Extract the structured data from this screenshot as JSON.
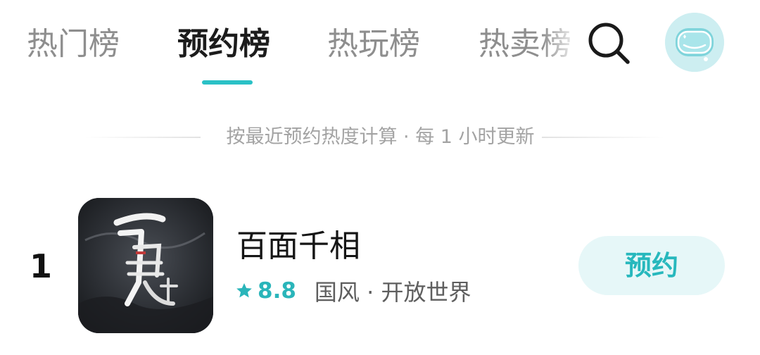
{
  "tabs": [
    {
      "label": "热门榜",
      "active": false
    },
    {
      "label": "预约榜",
      "active": true
    },
    {
      "label": "热玩榜",
      "active": false
    },
    {
      "label": "热卖榜",
      "active": false
    }
  ],
  "header": {
    "search_icon": "search-icon",
    "avatar_icon": "astronaut-avatar"
  },
  "hint": {
    "text": "按最近预约热度计算 · 每 1 小时更新"
  },
  "game": {
    "rank": "1",
    "title": "百面千相",
    "rating": "8.8",
    "tags": "国风 · 开放世界",
    "action_label": "预约",
    "icon": "game-cover-icon"
  },
  "colors": {
    "accent": "#2ac1c6",
    "rating": "#2ab5ba",
    "button_bg": "#e6f7f8",
    "inactive_tab": "#8e8e8e",
    "active_tab": "#1c1c1c"
  }
}
